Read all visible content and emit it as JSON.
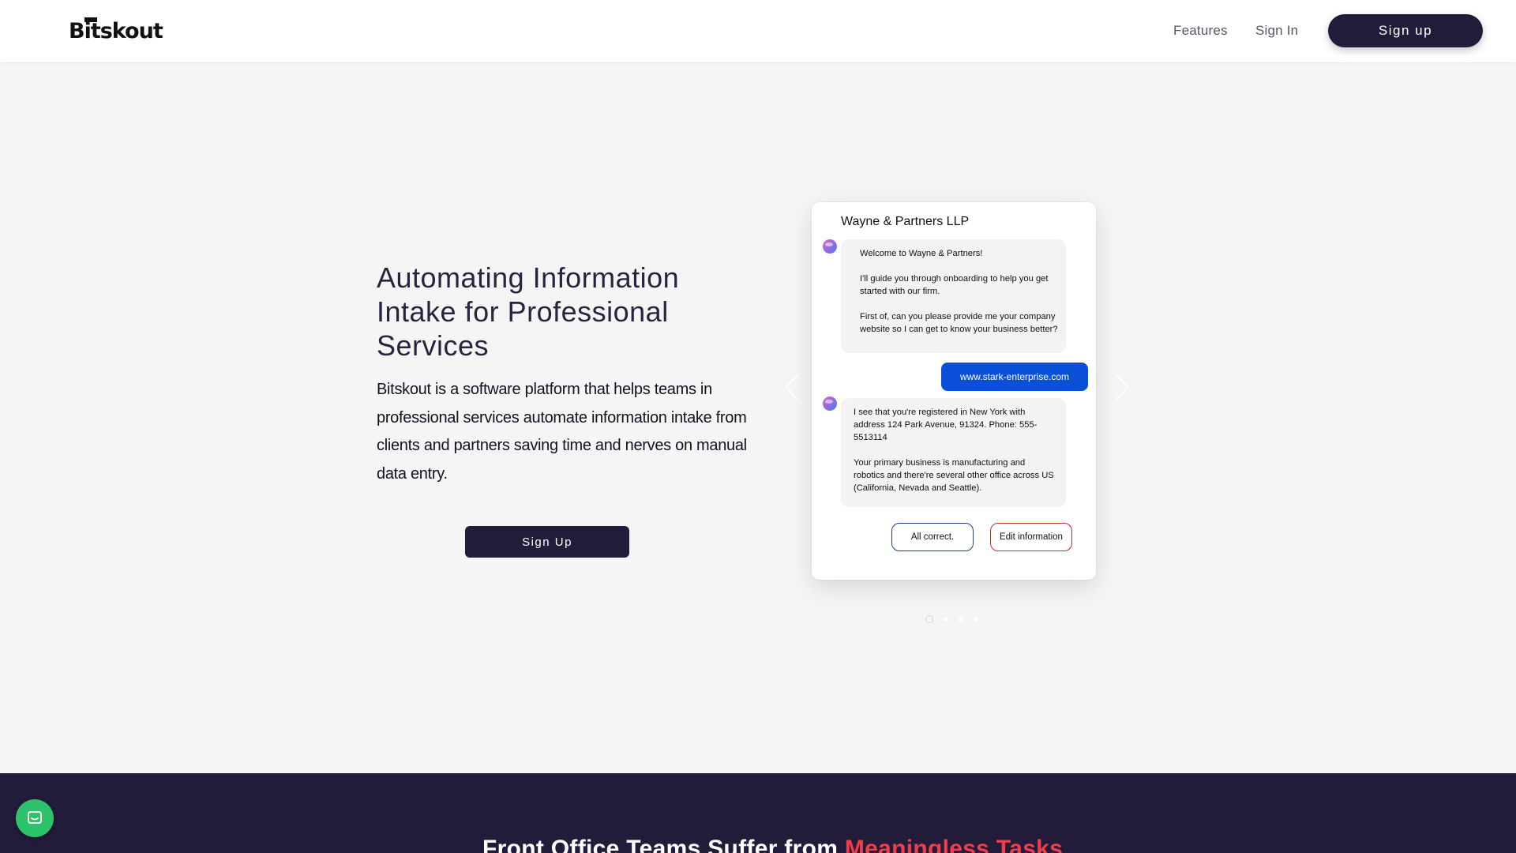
{
  "header": {
    "logo": "Bitskout",
    "nav": {
      "features": "Features",
      "sign_in": "Sign In",
      "sign_up": "Sign up"
    }
  },
  "hero": {
    "title": "Automating Information Intake for Professional Services",
    "description": "Bitskout is a software platform that helps teams in professional services automate information intake from clients and partners saving time and nerves on manual data entry.",
    "cta": "Sign Up"
  },
  "carousel": {
    "slide_count": 4,
    "active_slide": 1,
    "chat": {
      "firm_name": "Wayne & Partners LLP",
      "bot_message_1": {
        "line1": "Welcome to Wayne & Partners!",
        "line2": "I'll guide you through onboarding to help you get started with our firm.",
        "line3": "First of, can you please provide me your company website so I can get to know your business better?"
      },
      "user_message": "www.stark-enterprise.com",
      "bot_message_2": {
        "line1": "I see that you're registered in New York with address 124 Park Avenue, 91324. Phone: 555-5513114",
        "line2": "Your primary business is manufacturing and robotics and there're several other office across US (California, Nevada and Seattle)."
      },
      "actions": {
        "confirm": "All correct.",
        "edit": "Edit information"
      }
    }
  },
  "section2": {
    "heading_prefix": "Front Office Teams Suffer from ",
    "heading_accent": "Meaningless Tasks"
  },
  "colors": {
    "brand_dark": "#231b3a",
    "user_bubble": "#0a4fd8",
    "accent_red": "#ef3e4a",
    "chat_launcher": "#2ec26a"
  },
  "icons": {
    "launcher": "chat-bubble-icon",
    "prev": "chevron-left-icon",
    "next": "chevron-right-icon"
  }
}
